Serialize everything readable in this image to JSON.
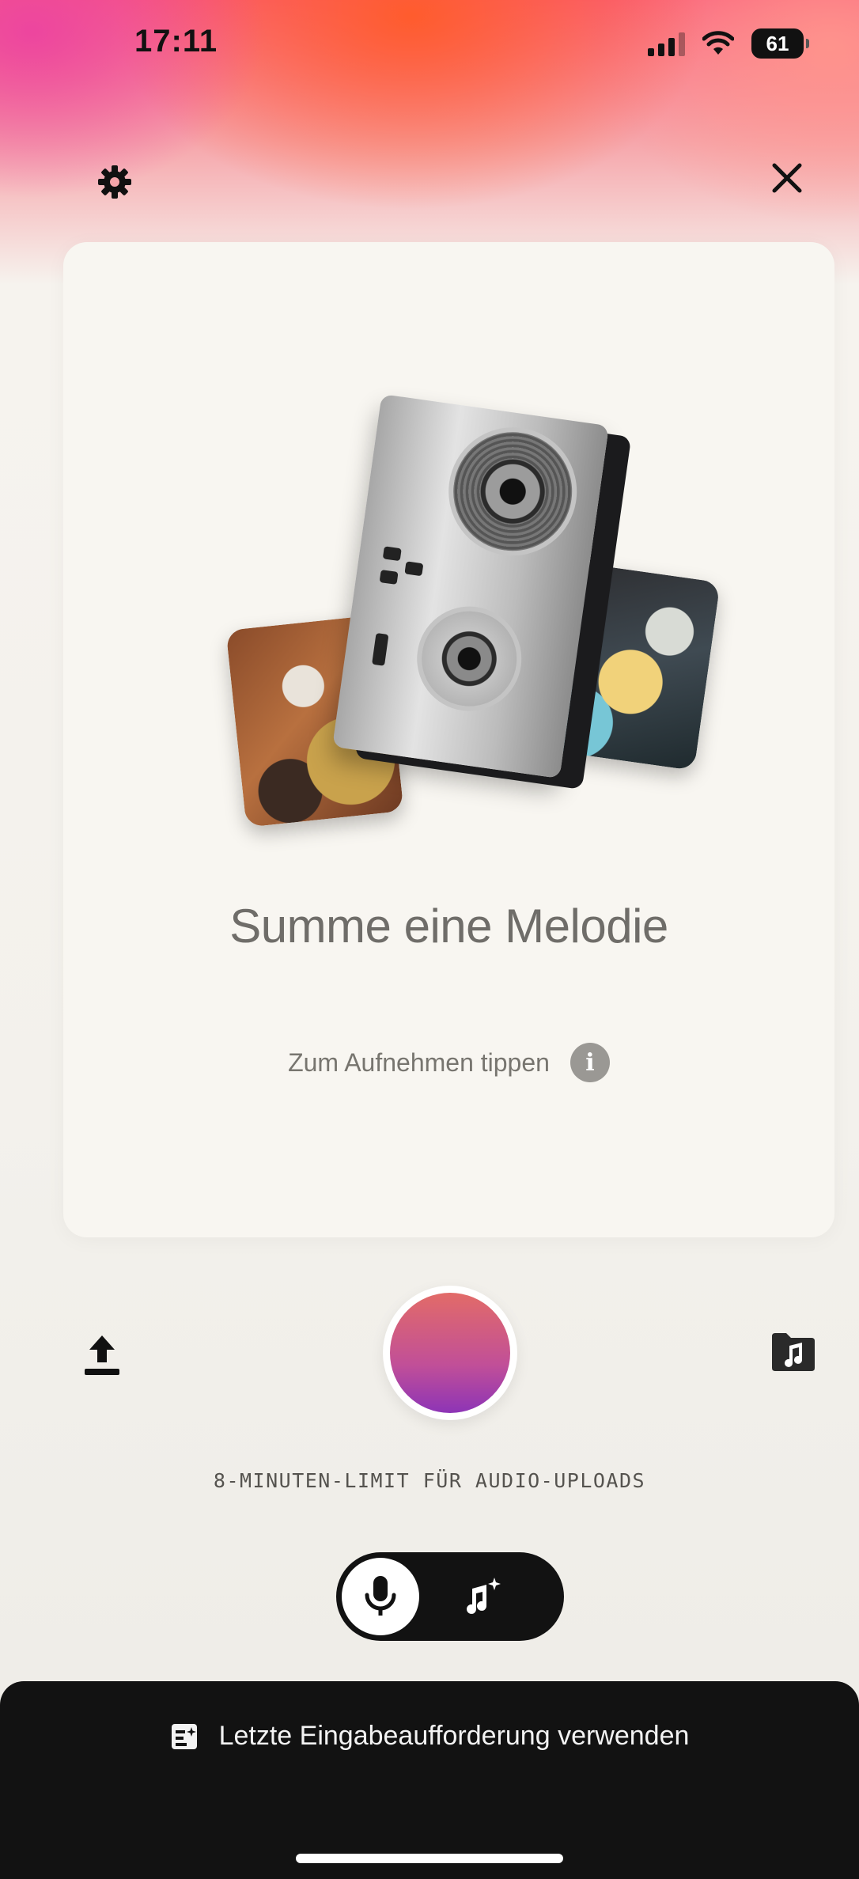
{
  "status_bar": {
    "time": "17:11",
    "battery": "61"
  },
  "colors": {
    "accent_gradient_start": "#e26b68",
    "accent_gradient_end": "#8d34b6",
    "dark_surface": "#121212",
    "card_background": "#f8f6f1"
  },
  "header": {
    "settings_icon": "gear-icon",
    "close_icon": "close-icon"
  },
  "card": {
    "headline": "Summe eine Melodie",
    "hint": "Zum Aufnehmen tippen",
    "info_icon": "info-icon"
  },
  "actions": {
    "upload_icon": "upload-icon",
    "music_folder_icon": "music-folder-icon",
    "record_icon": "record-button"
  },
  "limit_text": "8-MINUTEN-LIMIT FÜR AUDIO-UPLOADS",
  "mode_toggle": {
    "options": [
      {
        "icon": "microphone-icon",
        "selected": true
      },
      {
        "icon": "music-sparkle-icon",
        "selected": false
      }
    ]
  },
  "bottom_bar": {
    "action_label": "Letzte Eingabeaufforderung verwenden",
    "action_icon": "prompt-history-icon"
  }
}
